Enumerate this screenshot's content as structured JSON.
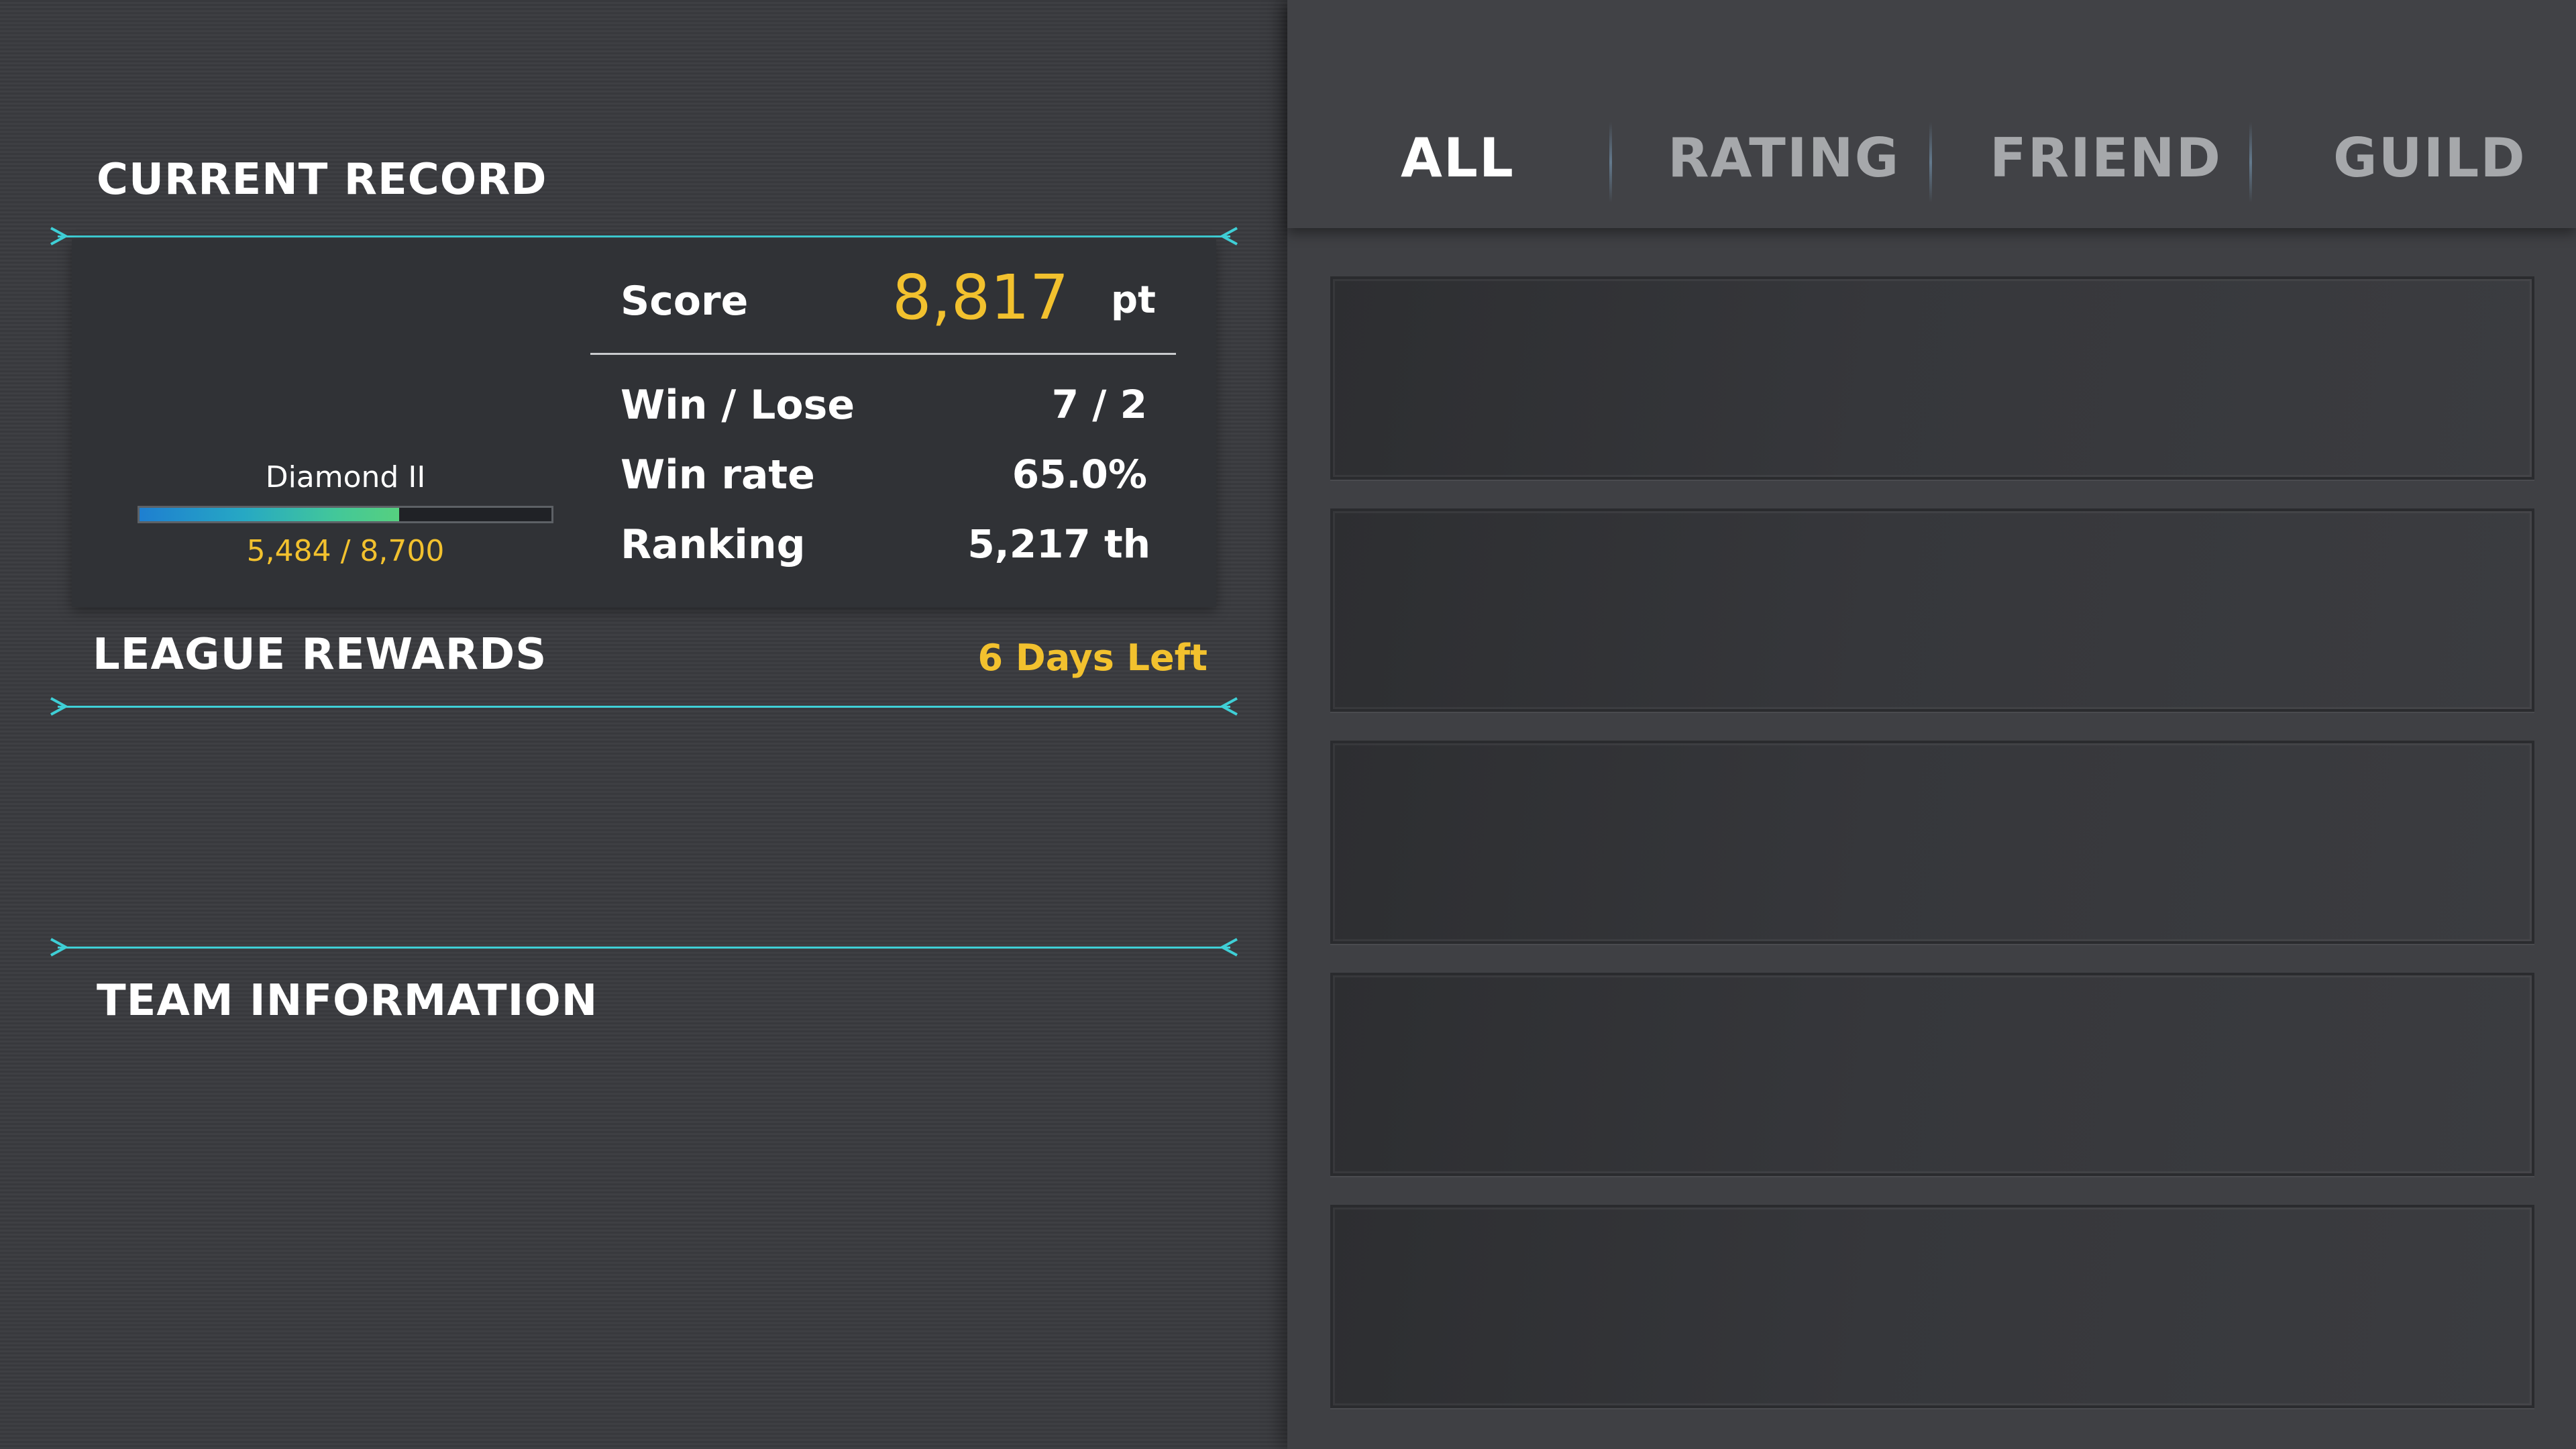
{
  "current_record": {
    "title": "CURRENT RECORD",
    "rank": {
      "name": "Diamond II",
      "progress_text": "5,484 / 8,700",
      "progress_fraction": 0.63
    },
    "score": {
      "label": "Score",
      "value": "8,817",
      "unit": "pt"
    },
    "stats": [
      {
        "label": "Win / Lose",
        "value": "7 / 2"
      },
      {
        "label": "Win rate",
        "value": "65.0%"
      },
      {
        "label": "Ranking",
        "value": "5,217 th"
      }
    ]
  },
  "league_rewards": {
    "title": "LEAGUE REWARDS",
    "time_left": "6 Days Left"
  },
  "team_information": {
    "title": "TEAM INFORMATION"
  },
  "ranking_tabs": {
    "active_index": 0,
    "items": [
      {
        "label": "ALL"
      },
      {
        "label": "RATING"
      },
      {
        "label": "FRIEND"
      },
      {
        "label": "GUILD"
      }
    ]
  },
  "ranking_list": {
    "item_count": 5
  },
  "colors": {
    "accent_cyan": "#3fcfd6",
    "highlight_gold": "#f2c12e",
    "panel_dark": "#303236",
    "background": "#3a3b3f"
  }
}
